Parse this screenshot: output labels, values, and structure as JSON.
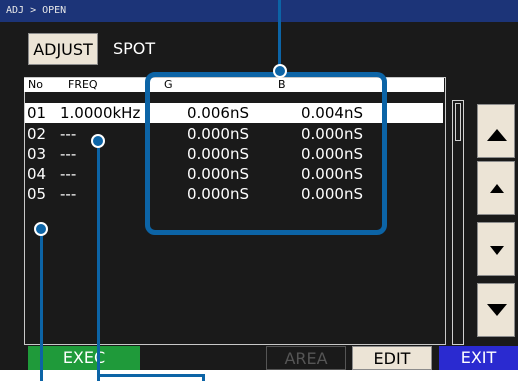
{
  "breadcrumb": "ADJ > OPEN",
  "mode_button": "ADJUST",
  "mode_label": "SPOT",
  "table": {
    "headers": {
      "no": "No",
      "freq": "FREQ",
      "g": "G",
      "b": "B"
    },
    "rows": [
      {
        "no": "01",
        "freq": "1.0000kHz",
        "g": "0.006nS",
        "b": "0.004nS"
      },
      {
        "no": "02",
        "freq": "---",
        "g": "0.000nS",
        "b": "0.000nS"
      },
      {
        "no": "03",
        "freq": "---",
        "g": "0.000nS",
        "b": "0.000nS"
      },
      {
        "no": "04",
        "freq": "---",
        "g": "0.000nS",
        "b": "0.000nS"
      },
      {
        "no": "05",
        "freq": "---",
        "g": "0.000nS",
        "b": "0.000nS"
      }
    ]
  },
  "buttons": {
    "exec": "EXEC",
    "area": "AREA",
    "edit": "EDIT",
    "exit": "EXIT"
  },
  "colors": {
    "title_bar": "#1c3478",
    "callout": "#0c64a6",
    "exec": "#1f9a3a",
    "exit": "#2a2ad0"
  },
  "icons": [
    "page-up-icon",
    "up-icon",
    "down-icon",
    "page-down-icon"
  ]
}
